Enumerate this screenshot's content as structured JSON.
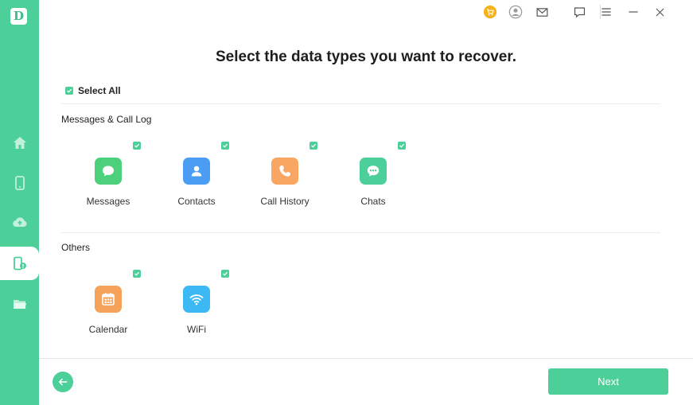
{
  "app": {
    "logo_letter": "D"
  },
  "colors": {
    "accent": "#4ccf98",
    "messages": "#4dd07c",
    "contacts": "#4a9df2",
    "call_history": "#f8a662",
    "chats": "#4ccf98",
    "calendar": "#f5a25a",
    "wifi": "#3cb8f5",
    "cart_badge": "#f5b21b"
  },
  "sidebar": {
    "items": [
      {
        "icon": "home-icon"
      },
      {
        "icon": "phone-icon"
      },
      {
        "icon": "cloud-upload-icon"
      },
      {
        "icon": "device-recovery-icon"
      },
      {
        "icon": "folder-icon"
      }
    ]
  },
  "titlebar": {
    "icons": [
      "cart-icon",
      "user-icon",
      "mail-icon",
      "feedback-icon",
      "menu-icon",
      "minimize-icon",
      "close-icon"
    ]
  },
  "main": {
    "title": "Select the data types you want to recover.",
    "select_all_label": "Select All",
    "sections": [
      {
        "label": "Messages & Call Log",
        "items": [
          {
            "label": "Messages",
            "icon": "message-bubble-icon"
          },
          {
            "label": "Contacts",
            "icon": "contact-person-icon"
          },
          {
            "label": "Call History",
            "icon": "phone-call-icon"
          },
          {
            "label": "Chats",
            "icon": "chat-bubble-icon"
          }
        ]
      },
      {
        "label": "Others",
        "items": [
          {
            "label": "Calendar",
            "icon": "calendar-icon"
          },
          {
            "label": "WiFi",
            "icon": "wifi-icon"
          }
        ]
      }
    ]
  },
  "footer": {
    "next_label": "Next"
  }
}
